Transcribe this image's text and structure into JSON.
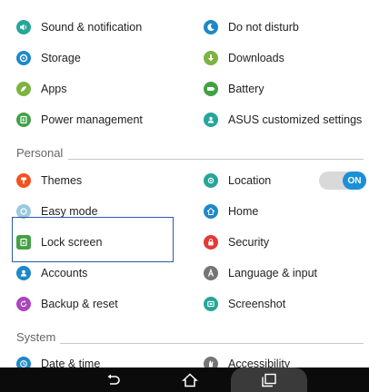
{
  "settings": {
    "rows_top": [
      {
        "left": {
          "label": "Sound & notification",
          "icon": "speaker-icon",
          "color": "#26a69a"
        },
        "right": {
          "label": "Do not disturb",
          "icon": "moon-icon",
          "color": "#1e88c8"
        }
      },
      {
        "left": {
          "label": "Storage",
          "icon": "storage-icon",
          "color": "#1e88c8"
        },
        "right": {
          "label": "Downloads",
          "icon": "download-icon",
          "color": "#7cb342"
        }
      },
      {
        "left": {
          "label": "Apps",
          "icon": "apps-icon",
          "color": "#7cb342"
        },
        "right": {
          "label": "Battery",
          "icon": "battery-icon",
          "color": "#43a047"
        }
      },
      {
        "left": {
          "label": "Power management",
          "icon": "power-management-icon",
          "color": "#43a047"
        },
        "right": {
          "label": "ASUS customized settings",
          "icon": "asus-settings-icon",
          "color": "#26a69a"
        }
      }
    ],
    "personal_header": "Personal",
    "rows_personal": [
      {
        "left": {
          "label": "Themes",
          "icon": "themes-icon",
          "color": "#f4511e"
        },
        "right": {
          "label": "Location",
          "icon": "location-icon",
          "color": "#26a69a"
        }
      },
      {
        "left": {
          "label": "Easy mode",
          "icon": "easy-mode-icon",
          "color": "#9ec9dc"
        },
        "right": {
          "label": "Home",
          "icon": "home-icon",
          "color": "#1e88c8"
        }
      },
      {
        "left": {
          "label": "Lock screen",
          "icon": "lock-screen-icon",
          "color": "#43a047"
        },
        "right": {
          "label": "Security",
          "icon": "security-icon",
          "color": "#e53935"
        }
      },
      {
        "left": {
          "label": "Accounts",
          "icon": "accounts-icon",
          "color": "#1e88c8"
        },
        "right": {
          "label": "Language & input",
          "icon": "language-icon",
          "color": "#757575"
        }
      },
      {
        "left": {
          "label": "Backup & reset",
          "icon": "backup-icon",
          "color": "#ab47bc"
        },
        "right": {
          "label": "Screenshot",
          "icon": "screenshot-icon",
          "color": "#26a69a"
        }
      }
    ],
    "system_header": "System",
    "rows_system": [
      {
        "left": {
          "label": "Date & time",
          "icon": "clock-icon",
          "color": "#1e88c8"
        },
        "right": {
          "label": "Accessibility",
          "icon": "accessibility-icon",
          "color": "#757575"
        }
      }
    ],
    "location_toggle": {
      "label": "ON",
      "state": "on"
    }
  },
  "navbar": {
    "buttons": [
      "back-icon",
      "home-nav-icon",
      "recent-apps-icon"
    ]
  }
}
